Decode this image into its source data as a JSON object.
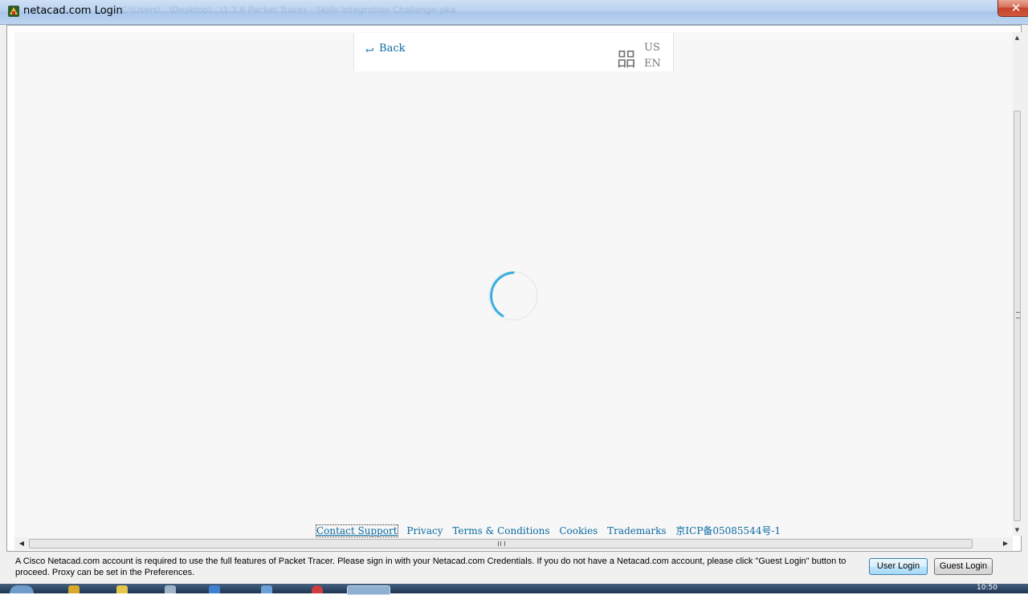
{
  "window": {
    "title": "netacad.com Login",
    "blurred_path": "...C:\\Users\\...\\Desktop\\...\\1.3.6 Packet Tracer - Skills Integration Challenge.pka",
    "close_label": "✕"
  },
  "page": {
    "back_icon": "↩",
    "back_label": "Back",
    "globe_icon": "㗊",
    "lang_country": "US",
    "lang_code": "EN"
  },
  "footer": {
    "links": [
      "Contact Support",
      "Privacy",
      "Terms & Conditions",
      "Cookies",
      "Trademarks",
      "京ICP备05085544号-1"
    ]
  },
  "dialog": {
    "info_text": "A Cisco Netacad.com account is required to use the full features of Packet Tracer. Please sign in with your Netacad.com Credentials. If you do not have a Netacad.com account, please click \"Guest Login\" button to proceed. Proxy can be set in the Preferences.",
    "user_login_label": "User Login",
    "guest_login_label": "Guest Login"
  },
  "scrollbar": {
    "up": "▲",
    "down": "▼",
    "left": "◀",
    "right": "▶"
  },
  "taskbar": {
    "clock": "10:50"
  },
  "colors": {
    "link": "#0a6aa0",
    "spinner": "#3aaee0",
    "web_bg": "#f7f7f7"
  }
}
